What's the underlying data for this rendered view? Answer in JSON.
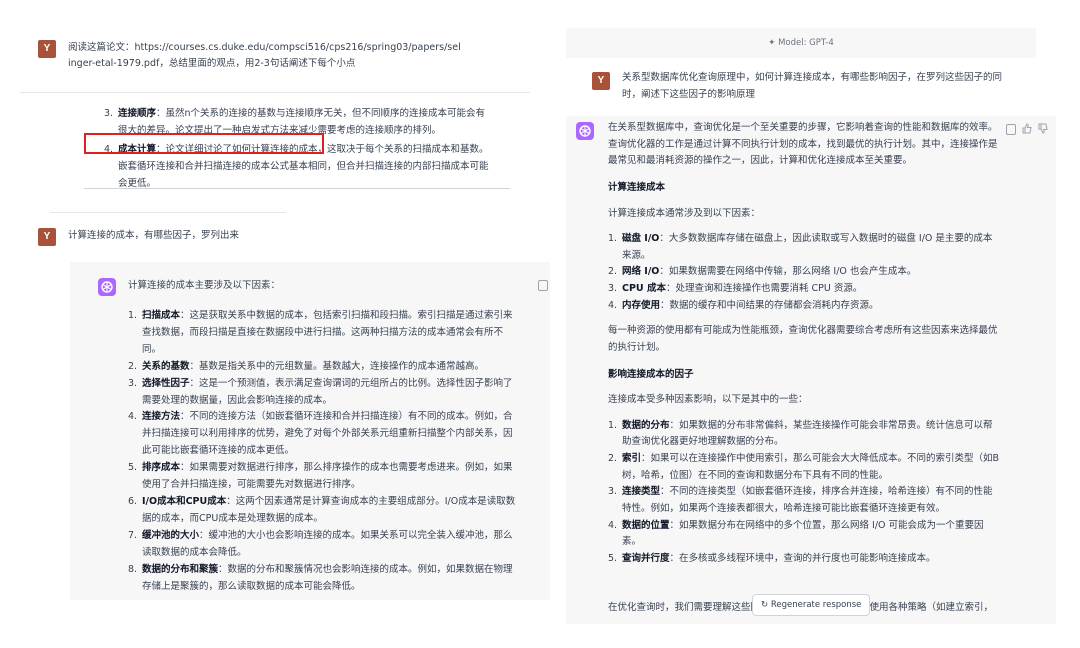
{
  "left_top": {
    "user_prompt": "阅读这篇论文：https://courses.cs.duke.edu/compsci516/cps216/spring03/papers/selinger-etal-1979.pdf，总结里面的观点，用2-3句话阐述下每个小点",
    "items": [
      {
        "num": "3.",
        "title": "连接顺序",
        "text": "：虽然n个关系的连接的基数与连接顺序无关，但不同顺序的连接成本可能会有很大的差异。论文提出了一种启发式方法来减少需要考虑的连接顺序的排列。"
      },
      {
        "num": "4.",
        "title": "成本计算",
        "text": "：论文详细讨论了如何计算连接的成本，这取决于每个关系的扫描成本和基数。嵌套循环连接和合并扫描连接的成本公式基本相同，但合并扫描连接的内部扫描成本可能会更低。"
      }
    ],
    "highlight_color": "#e02020"
  },
  "left_bottom": {
    "user_prompt": "计算连接的成本，有哪些因子，罗列出来",
    "intro": "计算连接的成本主要涉及以下因素：",
    "items": [
      {
        "num": "1.",
        "title": "扫描成本",
        "text": "：这是获取关系中数据的成本，包括索引扫描和段扫描。索引扫描是通过索引来查找数据，而段扫描是直接在数据段中进行扫描。这两种扫描方法的成本通常会有所不同。"
      },
      {
        "num": "2.",
        "title": "关系的基数",
        "text": "：基数是指关系中的元组数量。基数越大，连接操作的成本通常越高。"
      },
      {
        "num": "3.",
        "title": "选择性因子",
        "text": "：这是一个预测值，表示满足查询谓词的元组所占的比例。选择性因子影响了需要处理的数据量，因此会影响连接的成本。"
      },
      {
        "num": "4.",
        "title": "连接方法",
        "text": "：不同的连接方法（如嵌套循环连接和合并扫描连接）有不同的成本。例如，合并扫描连接可以利用排序的优势，避免了对每个外部关系元组重新扫描整个内部关系，因此可能比嵌套循环连接的成本更低。"
      },
      {
        "num": "5.",
        "title": "排序成本",
        "text": "：如果需要对数据进行排序，那么排序操作的成本也需要考虑进来。例如，如果使用了合并扫描连接，可能需要先对数据进行排序。"
      },
      {
        "num": "6.",
        "title": "I/O成本和CPU成本",
        "text": "：这两个因素通常是计算查询成本的主要组成部分。I/O成本是读取数据的成本，而CPU成本是处理数据的成本。"
      },
      {
        "num": "7.",
        "title": "缓冲池的大小",
        "text": "：缓冲池的大小也会影响连接的成本。如果关系可以完全装入缓冲池，那么读取数据的成本会降低。"
      },
      {
        "num": "8.",
        "title": "数据的分布和聚簇",
        "text": "：数据的分布和聚簇情况也会影响连接的成本。例如，如果数据在物理存储上是聚簇的，那么读取数据的成本可能会降低。"
      }
    ]
  },
  "right": {
    "model_label": "Model: GPT-4",
    "user_prompt": "关系型数据库优化查询原理中，如何计算连接成本，有哪些影响因子，在罗列这些因子的同时，阐述下这些因子的影响原理",
    "para1": "在关系型数据库中，查询优化是一个至关重要的步骤，它影响着查询的性能和数据库的效率。查询优化器的工作是通过计算不同执行计划的成本，找到最优的执行计划。其中，连接操作是最常见和最消耗资源的操作之一，因此，计算和优化连接成本至关重要。",
    "heading1": "计算连接成本",
    "para2": "计算连接成本通常涉及到以下因素：",
    "list1": [
      {
        "num": "1.",
        "title": "磁盘 I/O",
        "text": "：大多数数据库存储在磁盘上，因此读取或写入数据时的磁盘 I/O 是主要的成本来源。"
      },
      {
        "num": "2.",
        "title": "网络 I/O",
        "text": "：如果数据需要在网络中传输，那么网络 I/O 也会产生成本。"
      },
      {
        "num": "3.",
        "title": "CPU 成本",
        "text": "：处理查询和连接操作也需要消耗 CPU 资源。"
      },
      {
        "num": "4.",
        "title": "内存使用",
        "text": "：数据的缓存和中间结果的存储都会消耗内存资源。"
      }
    ],
    "para3": "每一种资源的使用都有可能成为性能瓶颈，查询优化器需要综合考虑所有这些因素来选择最优的执行计划。",
    "heading2": "影响连接成本的因子",
    "para4": "连接成本受多种因素影响，以下是其中的一些：",
    "list2": [
      {
        "num": "1.",
        "title": "数据的分布",
        "text": "：如果数据的分布非常偏斜，某些连接操作可能会非常昂贵。统计信息可以帮助查询优化器更好地理解数据的分布。"
      },
      {
        "num": "2.",
        "title": "索引",
        "text": "：如果可以在连接操作中使用索引，那么可能会大大降低成本。不同的索引类型（如B 树，哈希，位图）在不同的查询和数据分布下具有不同的性能。"
      },
      {
        "num": "3.",
        "title": "连接类型",
        "text": "：不同的连接类型（如嵌套循环连接，排序合并连接，哈希连接）有不同的性能特性。例如，如果两个连接表都很大，哈希连接可能比嵌套循环连接更有效。"
      },
      {
        "num": "4.",
        "title": "数据的位置",
        "text": "：如果数据分布在网络中的多个位置，那么网络 I/O 可能会成为一个重要因素。"
      },
      {
        "num": "5.",
        "title": "查询并行度",
        "text": "：在多核或多线程环境中，查询的并行度也可能影响连接成本。"
      }
    ],
    "para5_left": "在优化查询时，我们需要理解这些因",
    "para5_right": "并使用各种策略（如建立索引，",
    "regenerate_label": "Regenerate response"
  }
}
